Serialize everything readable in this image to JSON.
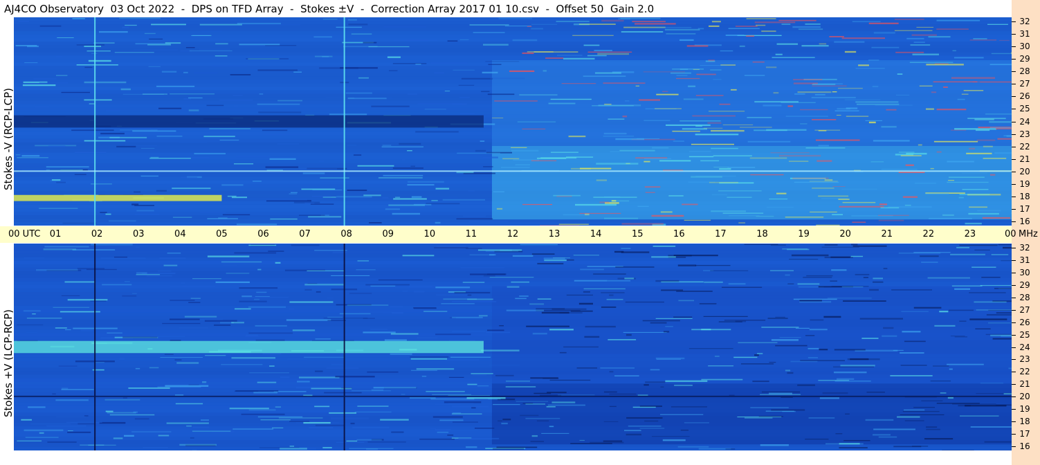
{
  "title": "AJ4CO Observatory  03 Oct 2022  -  DPS on TFD Array  -  Stokes ±V  -  Correction Array 2017 01 10.csv  -  Offset 50  Gain 2.0",
  "chart_data": [
    {
      "type": "heatmap",
      "name": "Stokes -V (RCP-LCP)",
      "ylabel": "Stokes -V (RCP-LCP)",
      "x_range_utc_hours": [
        0,
        24
      ],
      "y_range_mhz": [
        16,
        32
      ],
      "colormap": [
        "#0a2a8a",
        "#1f5fd6",
        "#3fa8f0",
        "#5fe8e8",
        "#f0f050",
        "#ff5050"
      ],
      "features": [
        {
          "label": "dark band",
          "freq_mhz": [
            23.5,
            24.5
          ],
          "utc": [
            0,
            11.3
          ]
        },
        {
          "label": "bright band",
          "freq_mhz": [
            17.5,
            18.0
          ],
          "utc": [
            0,
            5.0
          ]
        },
        {
          "label": "vertical line",
          "utc": 1.95
        },
        {
          "label": "vertical line",
          "utc": 7.95
        }
      ]
    },
    {
      "type": "heatmap",
      "name": "Stokes +V (LCP-RCP)",
      "ylabel": "Stokes +V (LCP-RCP)",
      "x_range_utc_hours": [
        0,
        24
      ],
      "y_range_mhz": [
        16,
        32
      ],
      "colormap": [
        "#0a2a8a",
        "#1f5fd6",
        "#3fa8f0",
        "#5fe8e8",
        "#f0f050",
        "#ff5050"
      ],
      "features": [
        {
          "label": "bright band",
          "freq_mhz": [
            23.5,
            24.5
          ],
          "utc": [
            0,
            11.3
          ]
        },
        {
          "label": "dark line",
          "utc": 1.95
        },
        {
          "label": "dark line",
          "utc": 7.95
        }
      ]
    }
  ],
  "x_axis": {
    "ticks": [
      "00 UTC",
      "01",
      "02",
      "03",
      "04",
      "05",
      "06",
      "07",
      "08",
      "09",
      "10",
      "11",
      "12",
      "13",
      "14",
      "15",
      "16",
      "17",
      "18",
      "19",
      "20",
      "21",
      "22",
      "23",
      "00"
    ],
    "unit": "MHz"
  },
  "y_axis": {
    "ticks": [
      "32",
      "31",
      "30",
      "29",
      "28",
      "27",
      "26",
      "25",
      "24",
      "23",
      "22",
      "21",
      "20",
      "19",
      "18",
      "17",
      "16"
    ]
  }
}
